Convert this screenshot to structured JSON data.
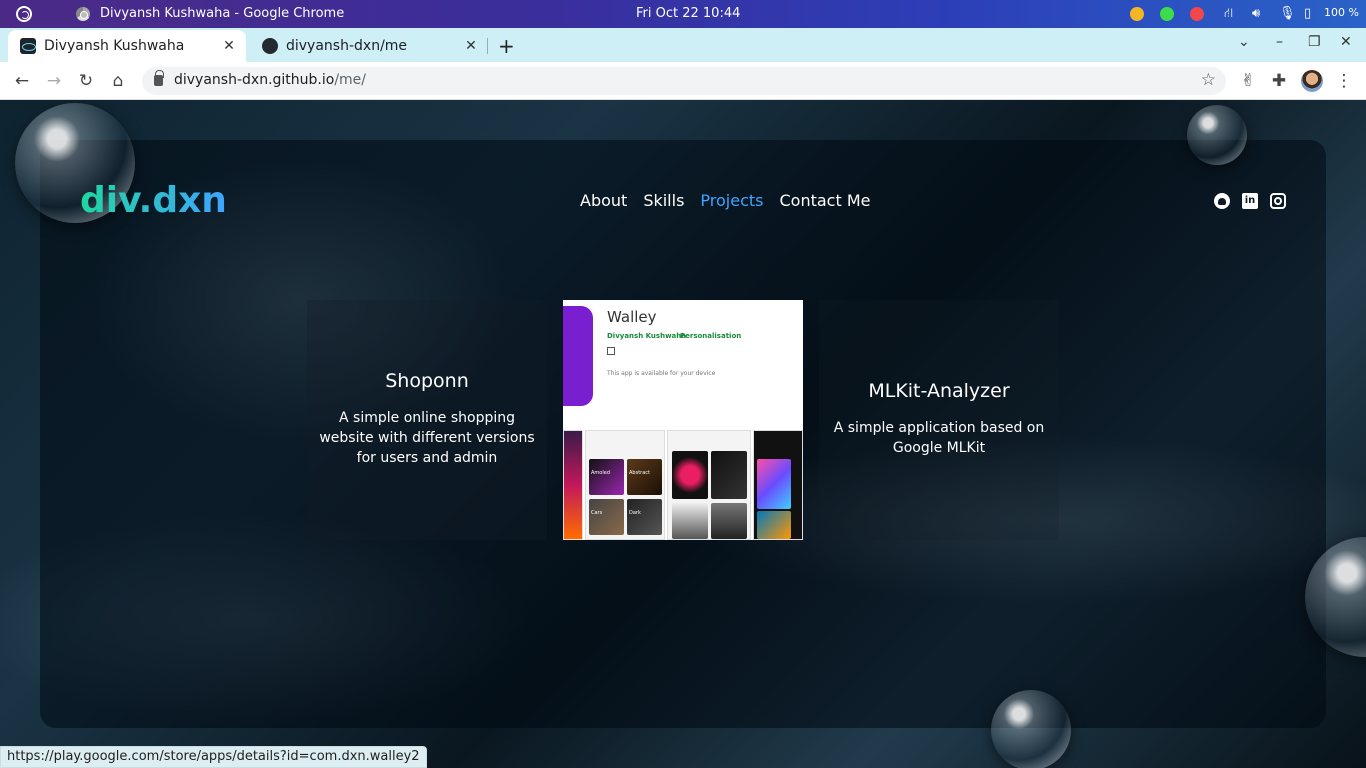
{
  "os": {
    "window_title": "Divyansh Kushwaha - Google Chrome",
    "clock": "Fri Oct 22  10:44",
    "battery": "100 %",
    "indicator_colors": [
      "#f5b625",
      "#3ddc4a",
      "#f1474b"
    ]
  },
  "browser": {
    "tabs": [
      {
        "label": "Divyansh Kushwaha",
        "active": true,
        "icon": "react-icon"
      },
      {
        "label": "divyansh-dxn/me",
        "active": false,
        "icon": "github-icon"
      }
    ],
    "url_host": "divyansh-dxn.github.io",
    "url_path": "/me/",
    "status_url": "https://play.google.com/store/apps/details?id=com.dxn.walley2"
  },
  "site": {
    "logo": "div.dxn",
    "nav": [
      {
        "label": "About",
        "active": false
      },
      {
        "label": "Skills",
        "active": false
      },
      {
        "label": "Projects",
        "active": true
      },
      {
        "label": "Contact Me",
        "active": false
      }
    ],
    "social_icons": [
      "github-icon",
      "linkedin-icon",
      "instagram-icon"
    ],
    "linkedin_glyph": "in",
    "accent_color": "#3fa4ff",
    "logo_gradient": [
      "#1fd6a0",
      "#3fa4ff"
    ],
    "projects": [
      {
        "title": "Shoponn",
        "description": "A simple online shopping website with different versions for users and admin"
      },
      {
        "title": "Walley",
        "developer": "Divyansh Kushwaha",
        "category": "Personalisation",
        "availability": "This app is available for your device"
      },
      {
        "title": "MLKit-Analyzer",
        "description": "A simple application based on Google MLKit"
      }
    ],
    "walley_shot_labels": [
      "Amoled",
      "Abstract",
      "Cars",
      "Dark"
    ]
  }
}
